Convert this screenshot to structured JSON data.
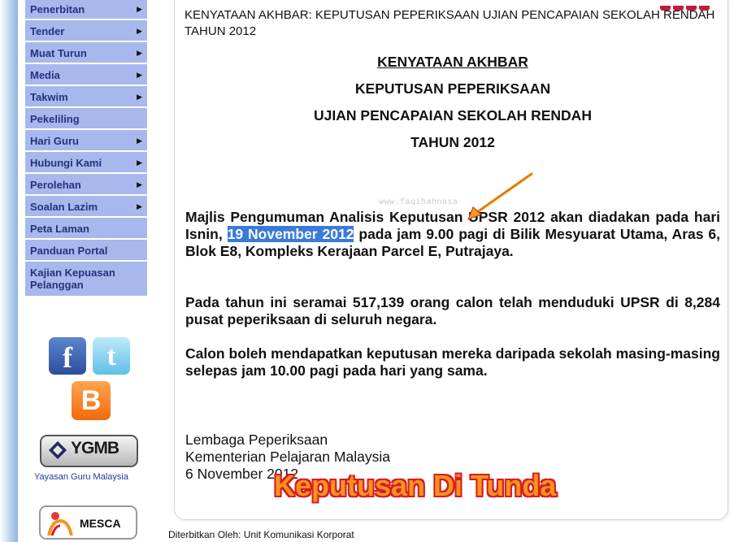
{
  "sidebar": {
    "items": [
      {
        "label": "Penerbitan",
        "arrow": true
      },
      {
        "label": "Tender",
        "arrow": true
      },
      {
        "label": "Muat Turun",
        "arrow": true
      },
      {
        "label": "Media",
        "arrow": true
      },
      {
        "label": "Takwim",
        "arrow": true
      },
      {
        "label": "Pekeliling",
        "arrow": false
      },
      {
        "label": "Hari Guru",
        "arrow": true
      },
      {
        "label": "Hubungi Kami",
        "arrow": true
      },
      {
        "label": "Perolehan",
        "arrow": true
      },
      {
        "label": "Soalan Lazim",
        "arrow": true
      },
      {
        "label": "Peta Laman",
        "arrow": false
      },
      {
        "label": "Panduan Portal",
        "arrow": false
      },
      {
        "label": "Kajian Kepuasan Pelanggan",
        "arrow": false
      }
    ],
    "arrow_glyph": "▶",
    "social": {
      "facebook": "f",
      "twitter": "t",
      "blogger": "B"
    },
    "ygmb": {
      "logo_text": "YGMB",
      "caption": "Yayasan Guru Malaysia"
    },
    "mesca": {
      "logo_text": "MESCA"
    }
  },
  "article": {
    "title": "KENYATAAN AKHBAR: KEPUTUSAN PEPERIKSAAN UJIAN PENCAPAIAN SEKOLAH RENDAH TAHUN 2012",
    "headings": [
      "KENYATAAN AKHBAR",
      "KEPUTUSAN PEPERIKSAAN",
      "UJIAN PENCAPAIAN SEKOLAH RENDAH",
      "TAHUN 2012"
    ],
    "watermark": "www.faqihahnasa",
    "p1_before": "Majlis Pengumuman Analisis Keputusan UPSR 2012 akan diadakan pada hari Isnin, ",
    "p1_highlight": "19 November 2012",
    "p1_after": " pada jam 9.00 pagi di Bilik Mesyuarat Utama, Aras 6, Blok E8, Kompleks Kerajaan Parcel E, Putrajaya.",
    "p2": "Pada tahun ini seramai 517,139 orang calon telah menduduki UPSR di 8,284 pusat peperiksaan di seluruh negara.",
    "p3": "Calon boleh mendapatkan keputusan mereka daripada sekolah masing-masing selepas jam 10.00 pagi pada hari yang sama.",
    "signature": [
      "Lembaga Peperiksaan",
      "Kementerian Pelajaran Malaysia",
      "6 November 2012"
    ]
  },
  "overlay_text": "Keputusan Di Tunda",
  "footer": "Diterbitkan Oleh: Unit Komunikasi Korporat",
  "colors": {
    "menu_bg": "#a8b8ec",
    "menu_text": "#24327e",
    "highlight": "#3b7ad8",
    "overlay_fill": "#f7931e",
    "overlay_outline": "#d81b24",
    "arrow": "#e8a317"
  }
}
